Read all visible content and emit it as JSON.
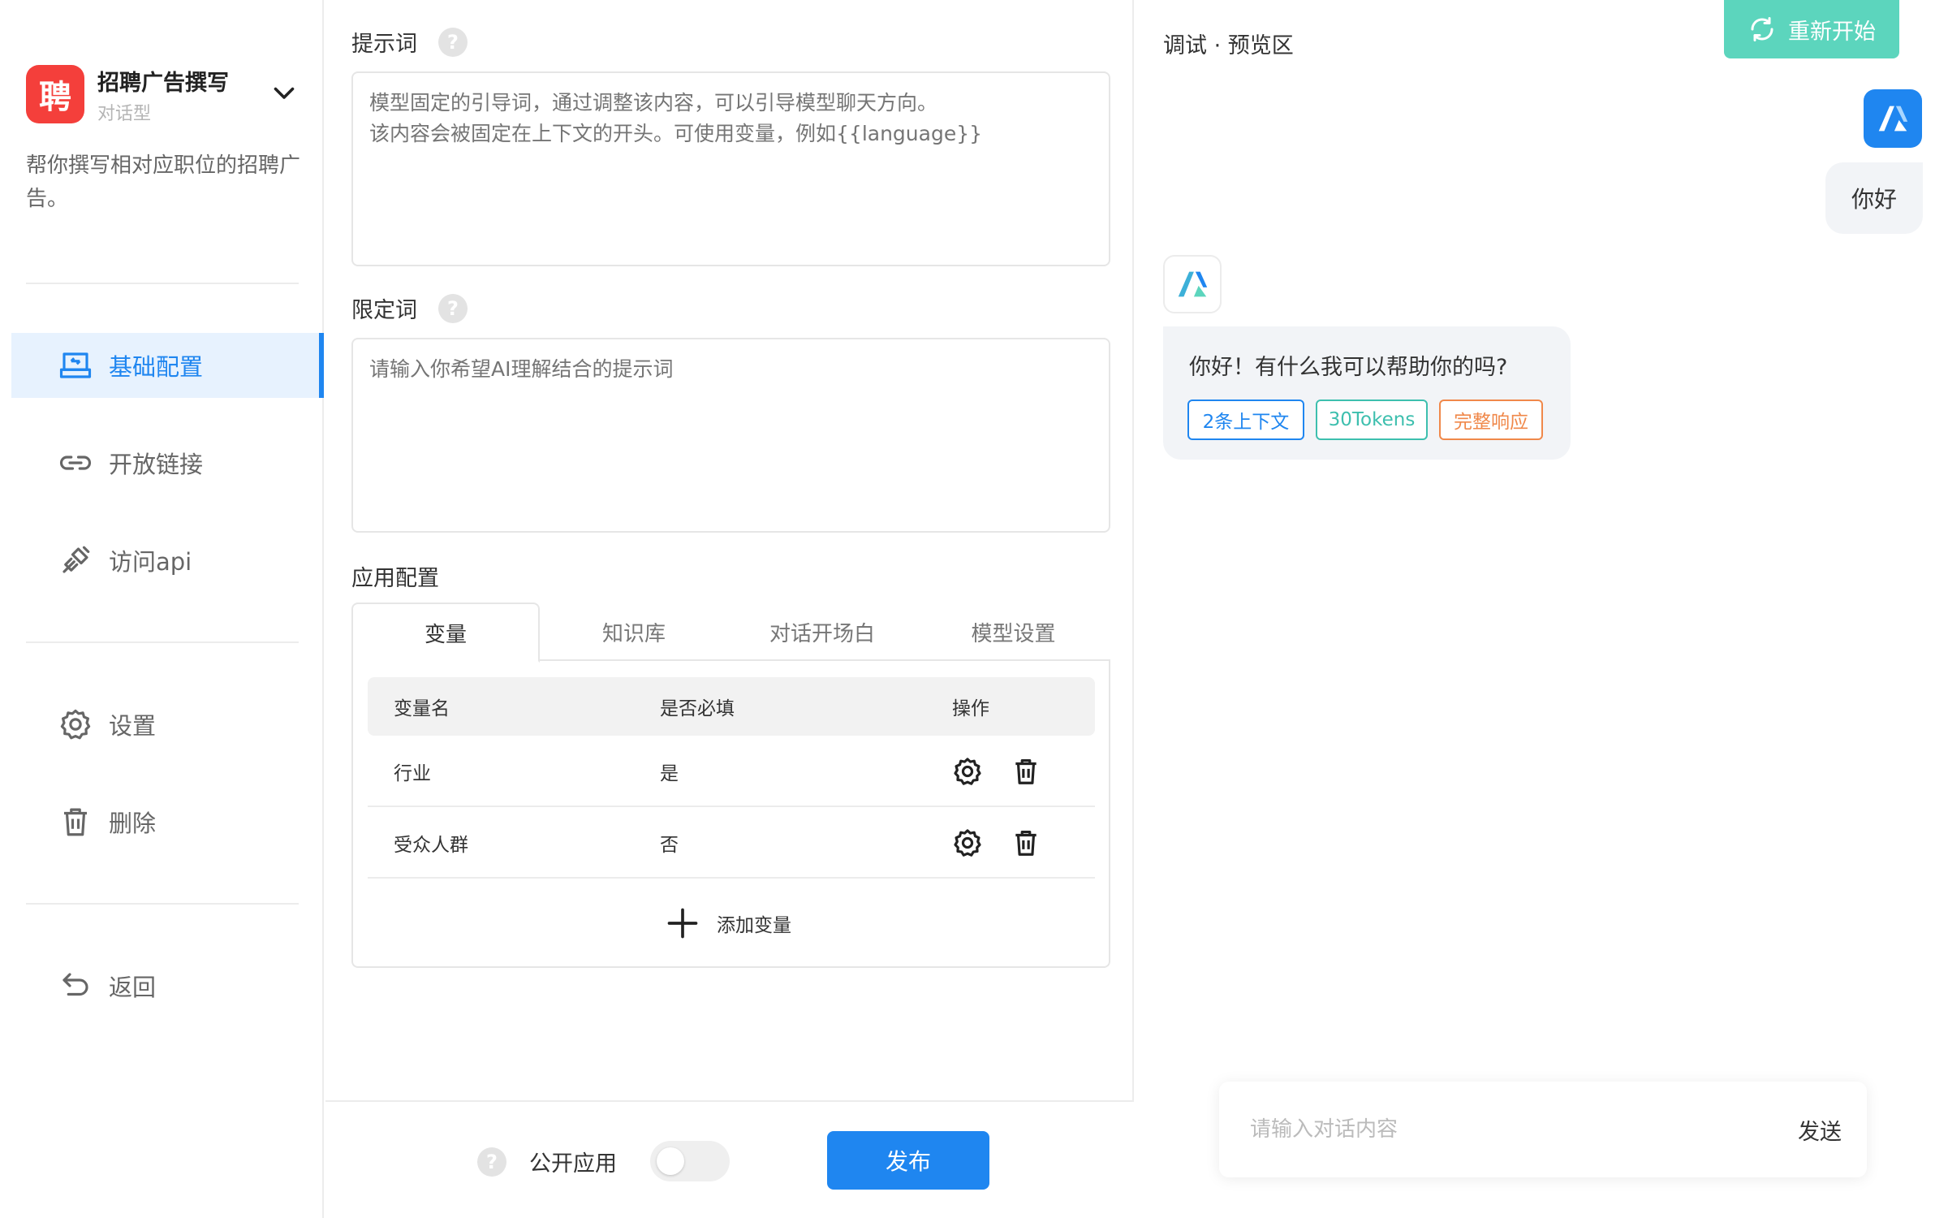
{
  "app": {
    "logo_char": "聘",
    "name": "招聘广告撰写",
    "type": "对话型",
    "description": "帮你撰写相对应职位的招聘广告。"
  },
  "nav": {
    "items": [
      {
        "label": "基础配置",
        "icon": "dashboard-icon",
        "active": true
      },
      {
        "label": "开放链接",
        "icon": "link-icon",
        "active": false
      },
      {
        "label": "访问api",
        "icon": "plug-icon",
        "active": false
      },
      {
        "label": "设置",
        "icon": "gear-icon",
        "active": false
      },
      {
        "label": "删除",
        "icon": "trash-icon",
        "active": false
      },
      {
        "label": "返回",
        "icon": "back-arrow-icon",
        "active": false
      }
    ]
  },
  "prompt": {
    "label": "提示词",
    "placeholder": "模型固定的引导词，通过调整该内容，可以引导模型聊天方向。\n该内容会被固定在上下文的开头。可使用变量，例如{{language}}",
    "value": ""
  },
  "limit": {
    "label": "限定词",
    "placeholder": "请输入你希望AI理解结合的提示词",
    "value": ""
  },
  "config": {
    "label": "应用配置",
    "tabs": [
      "变量",
      "知识库",
      "对话开场白",
      "模型设置"
    ],
    "active_tab": 0,
    "table": {
      "headers": [
        "变量名",
        "是否必填",
        "操作"
      ],
      "rows": [
        {
          "name": "行业",
          "required": "是"
        },
        {
          "name": "受众人群",
          "required": "否"
        }
      ]
    },
    "add_variable_label": "添加变量"
  },
  "publish": {
    "public_label": "公开应用",
    "public_enabled": false,
    "publish_label": "发布"
  },
  "preview": {
    "title": "调试 · 预览区",
    "restart_label": "重新开始",
    "user_message": "你好",
    "bot_message": "你好！有什么我可以帮助你的吗?",
    "badges": [
      {
        "text": "2条上下文",
        "color": "#1f86f0"
      },
      {
        "text": "30Tokens",
        "color": "#3dbfae"
      },
      {
        "text": "完整响应",
        "color": "#f0884a"
      }
    ],
    "input_placeholder": "请输入对话内容",
    "send_label": "发送"
  },
  "colors": {
    "primary": "#1f86f0",
    "teal": "#5cd5bd",
    "logo_red": "#f43f3b"
  }
}
